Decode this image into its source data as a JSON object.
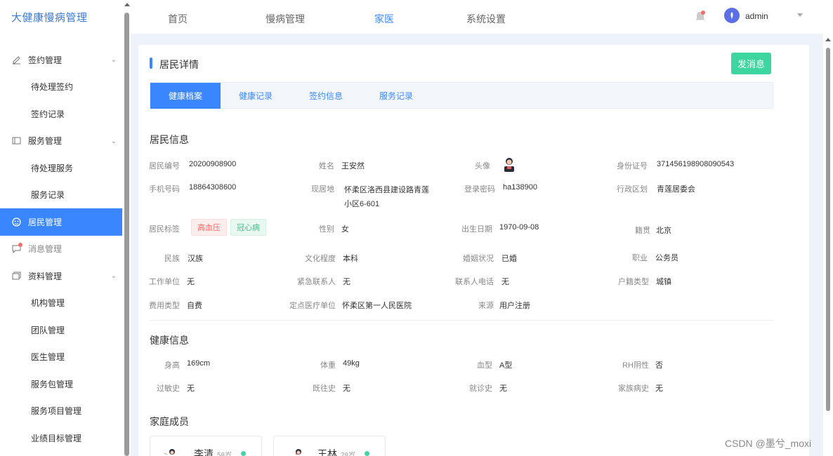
{
  "brand": "大健康慢病管理",
  "sidebar": {
    "items": [
      {
        "label": "签约管理",
        "type": "group"
      },
      {
        "label": "待处理签约",
        "type": "sub"
      },
      {
        "label": "签约记录",
        "type": "sub"
      },
      {
        "label": "服务管理",
        "type": "group"
      },
      {
        "label": "待处理服务",
        "type": "sub"
      },
      {
        "label": "服务记录",
        "type": "sub"
      },
      {
        "label": "居民管理",
        "type": "active"
      },
      {
        "label": "消息管理",
        "type": "muted"
      },
      {
        "label": "资料管理",
        "type": "group"
      },
      {
        "label": "机构管理",
        "type": "sub"
      },
      {
        "label": "团队管理",
        "type": "sub"
      },
      {
        "label": "医生管理",
        "type": "sub"
      },
      {
        "label": "服务包管理",
        "type": "sub"
      },
      {
        "label": "服务项目管理",
        "type": "sub"
      },
      {
        "label": "业绩目标管理",
        "type": "sub"
      }
    ]
  },
  "header": {
    "nav": [
      "首页",
      "慢病管理",
      "家医",
      "系统设置"
    ],
    "active_nav": "家医",
    "user": "admin"
  },
  "page": {
    "title": "居民详情",
    "send_button": "发消息",
    "tabs": [
      "健康档案",
      "健康记录",
      "签约信息",
      "服务记录"
    ]
  },
  "resident": {
    "section": "居民信息",
    "labels": {
      "id": "居民编号",
      "name": "姓名",
      "avatar": "头像",
      "idcard": "身份证号",
      "phone": "手机号码",
      "address": "现居地",
      "password": "登录密码",
      "district": "行政区划",
      "tags": "居民标签",
      "gender": "性别",
      "birth": "出生日期",
      "native": "籍贯",
      "ethnic": "民族",
      "edu": "文化程度",
      "marital": "婚姻状况",
      "job": "职业",
      "work": "工作单位",
      "emergency": "紧急联系人",
      "contact_phone": "联系人电话",
      "household": "户籍类型",
      "fee": "费用类型",
      "hospital": "定点医疗单位",
      "source": "来源"
    },
    "values": {
      "id": "20200908900",
      "name": "王安然",
      "idcard": "371456198908090543",
      "phone": "18864308600",
      "address_line1": "怀柔区洛西县建设路青莲",
      "address_line2": "小区6-601",
      "password": "ha138900",
      "district": "青莲居委会",
      "tag1": "高血压",
      "tag2": "冠心病",
      "gender": "女",
      "birth": "1970-09-08",
      "native": "北京",
      "ethnic": "汉族",
      "edu": "本科",
      "marital": "已婚",
      "job": "公务员",
      "work": "无",
      "emergency": "无",
      "contact_phone": "无",
      "household": "城镇",
      "fee": "自费",
      "hospital": "怀柔区第一人民医院",
      "source": "用户注册"
    }
  },
  "health": {
    "section": "健康信息",
    "labels": {
      "height": "身高",
      "weight": "体重",
      "blood": "血型",
      "rh": "RH阴性",
      "allergy": "过敏史",
      "past": "既往史",
      "visit": "就诊史",
      "family": "家族病史"
    },
    "values": {
      "height": "169cm",
      "weight": "49kg",
      "blood": "A型",
      "rh": "否",
      "allergy": "无",
      "past": "无",
      "visit": "无",
      "family": "无"
    }
  },
  "family": {
    "section": "家庭成员",
    "members": [
      {
        "name": "李清",
        "age": "58岁"
      },
      {
        "name": "王林",
        "age": "28岁"
      }
    ]
  },
  "watermark": "CSDN @墨兮_moxi",
  "colors": {
    "primary": "#3a86ff",
    "success": "#3dd6a0",
    "danger": "#f56c6c"
  }
}
